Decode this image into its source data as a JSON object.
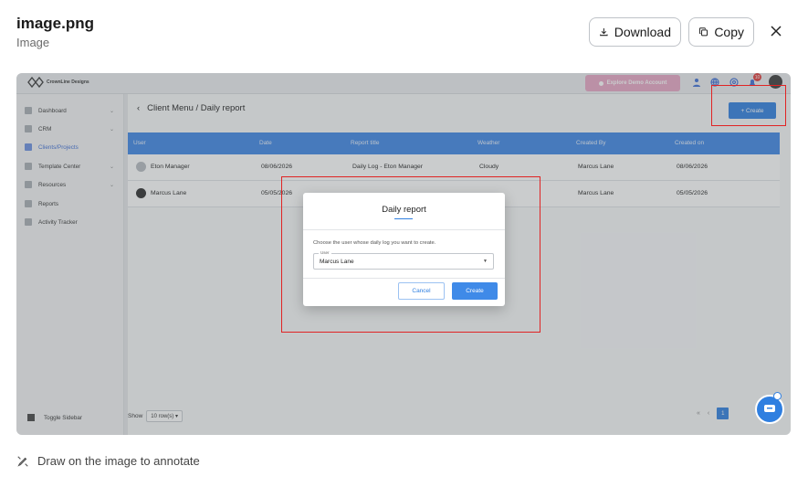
{
  "viewer": {
    "title": "image.png",
    "subtitle": "Image",
    "download_label": "Download",
    "copy_label": "Copy",
    "annotate_label": "Draw on the image to annotate"
  },
  "app": {
    "brand": "CrownLine Designs",
    "explore_label": "Explore Demo Account",
    "notification_count": "10",
    "sidebar": {
      "items": [
        {
          "label": "Dashboard",
          "has_chevron": true
        },
        {
          "label": "CRM",
          "has_chevron": true
        },
        {
          "label": "Clients/Projects",
          "has_chevron": false,
          "active": true
        },
        {
          "label": "Template Center",
          "has_chevron": true
        },
        {
          "label": "Resources",
          "has_chevron": true
        },
        {
          "label": "Reports",
          "has_chevron": false
        },
        {
          "label": "Activity Tracker",
          "has_chevron": false
        }
      ],
      "toggle_label": "Toggle Sidebar"
    },
    "breadcrumb": "Client Menu / Daily report",
    "create_label": "+ Create",
    "table": {
      "columns": [
        "User",
        "Date",
        "Report title",
        "Weather",
        "Created By",
        "Created on"
      ],
      "rows": [
        [
          "Eton Manager",
          "08/06/2026",
          "Daily Log - Eton Manager",
          "Cloudy",
          "Marcus Lane",
          "08/06/2026"
        ],
        [
          "Marcus Lane",
          "05/05/2026",
          "",
          "",
          "Marcus Lane",
          "05/05/2026"
        ]
      ]
    },
    "footer": {
      "show_label": "Show",
      "rows_value": "10 row(s)",
      "page": "1"
    },
    "modal": {
      "title": "Daily report",
      "prompt": "Choose the user whose daily log you want to create.",
      "field_label": "User",
      "field_value": "Marcus Lane",
      "cancel_label": "Cancel",
      "create_label": "Create"
    }
  },
  "colors": {
    "accent": "#2f7fe0",
    "header": "#3f87e6",
    "annotation": "#e02424"
  }
}
